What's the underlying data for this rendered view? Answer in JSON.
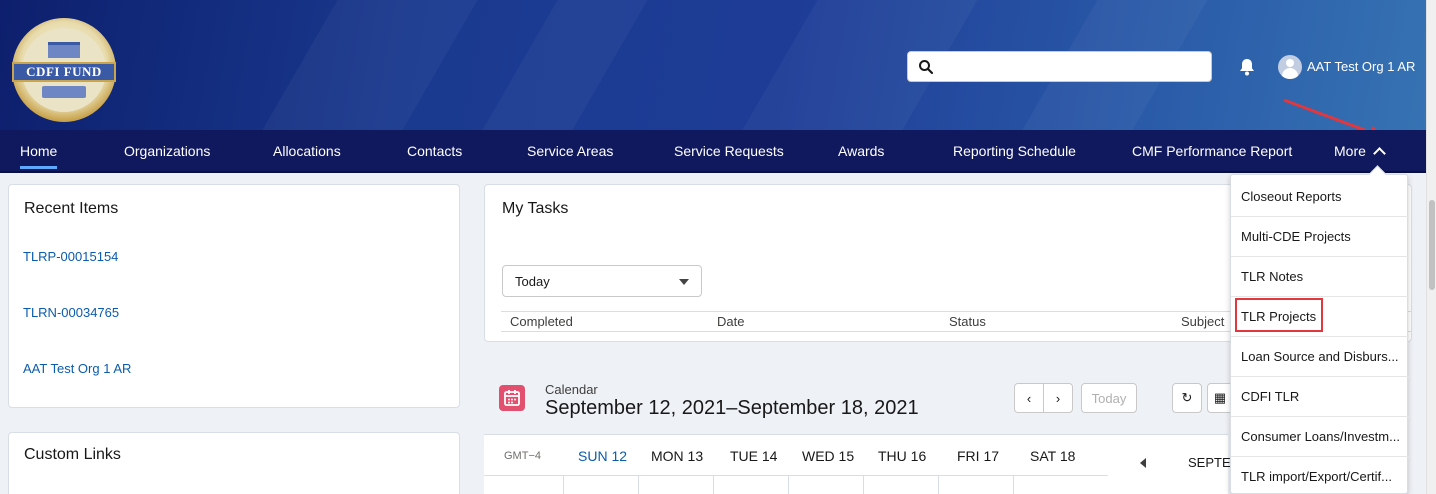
{
  "header": {
    "logo_text": "CDFI FUND",
    "search": {
      "placeholder": ""
    },
    "user_name": "AAT Test Org 1 AR"
  },
  "nav": {
    "items": [
      "Home",
      "Organizations",
      "Allocations",
      "Contacts",
      "Service Areas",
      "Service Requests",
      "Awards",
      "Reporting Schedule",
      "CMF Performance Report"
    ],
    "more_label": "More",
    "active": "Home"
  },
  "recent_items": {
    "title": "Recent Items",
    "links": [
      "TLRP-00015154",
      "TLRN-00034765",
      "AAT Test Org 1 AR"
    ]
  },
  "custom_links": {
    "title": "Custom Links"
  },
  "my_tasks": {
    "title": "My Tasks",
    "filter_value": "Today",
    "columns": [
      "Completed",
      "Date",
      "Status",
      "Subject"
    ]
  },
  "calendar": {
    "label": "Calendar",
    "range": "September 12, 2021–September 18, 2021",
    "today_button": "Today",
    "gmt": "GMT−4",
    "days": [
      "SUN 12",
      "MON 13",
      "TUE 14",
      "WED 15",
      "THU 16",
      "FRI 17",
      "SAT 18"
    ],
    "side_month": "SEPTEI"
  },
  "more_menu": {
    "items": [
      "Closeout Reports",
      "Multi-CDE Projects",
      "TLR Notes",
      "TLR Projects",
      "Loan Source and Disburs...",
      "CDFI TLR",
      "Consumer Loans/Investm...",
      "TLR import/Export/Certif..."
    ],
    "highlighted": "TLR Projects"
  },
  "colors": {
    "nav_bg": "#10195e",
    "link": "#0b5cab",
    "highlight": "#e0383e",
    "calendar_icon": "#e3506f"
  }
}
